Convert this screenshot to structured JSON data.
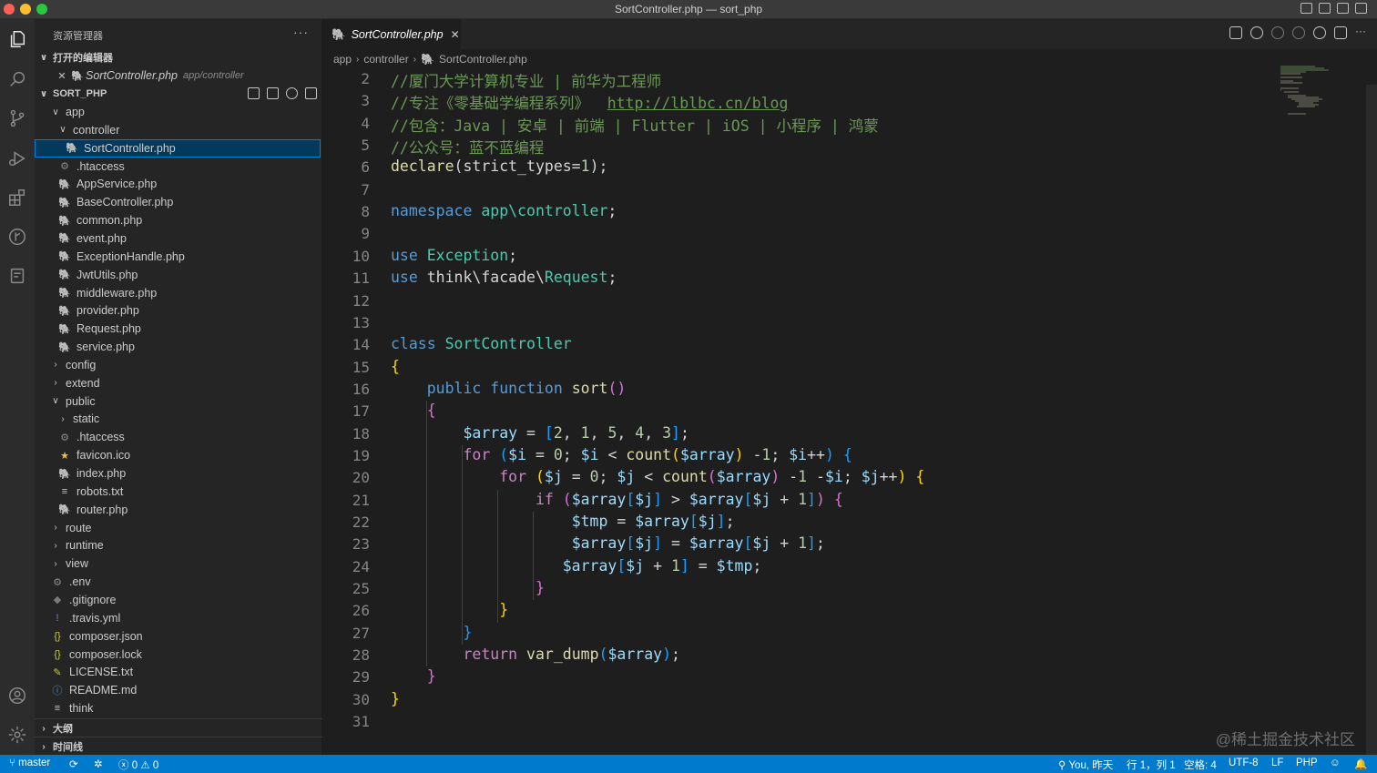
{
  "window": {
    "title": "SortController.php — sort_php"
  },
  "activity_bar": [
    "explorer-icon",
    "search-icon",
    "source-control-icon",
    "run-debug-icon",
    "extensions-icon",
    "git-graph-icon",
    "remote-icon",
    "account-icon",
    "settings-gear-icon"
  ],
  "sidebar": {
    "title": "资源管理器",
    "more": "···",
    "open_editors": {
      "header": "打开的编辑器",
      "file": "SortController.php",
      "path": "app/controller"
    },
    "project": {
      "header": "SORT_PHP"
    },
    "tree": [
      {
        "label": "app",
        "kind": "folder-open",
        "depth": 0
      },
      {
        "label": "controller",
        "kind": "folder-open",
        "depth": 1
      },
      {
        "label": "SortController.php",
        "kind": "php",
        "depth": 2,
        "selected": true
      },
      {
        "label": ".htaccess",
        "kind": "cog",
        "depth": 1
      },
      {
        "label": "AppService.php",
        "kind": "php",
        "depth": 1
      },
      {
        "label": "BaseController.php",
        "kind": "php",
        "depth": 1
      },
      {
        "label": "common.php",
        "kind": "php",
        "depth": 1
      },
      {
        "label": "event.php",
        "kind": "php",
        "depth": 1
      },
      {
        "label": "ExceptionHandle.php",
        "kind": "php",
        "depth": 1
      },
      {
        "label": "JwtUtils.php",
        "kind": "php",
        "depth": 1
      },
      {
        "label": "middleware.php",
        "kind": "php",
        "depth": 1
      },
      {
        "label": "provider.php",
        "kind": "php",
        "depth": 1
      },
      {
        "label": "Request.php",
        "kind": "php",
        "depth": 1
      },
      {
        "label": "service.php",
        "kind": "php",
        "depth": 1
      },
      {
        "label": "config",
        "kind": "folder",
        "depth": 0
      },
      {
        "label": "extend",
        "kind": "folder",
        "depth": 0
      },
      {
        "label": "public",
        "kind": "folder-open",
        "depth": 0
      },
      {
        "label": "static",
        "kind": "folder",
        "depth": 1
      },
      {
        "label": ".htaccess",
        "kind": "cog",
        "depth": 1
      },
      {
        "label": "favicon.ico",
        "kind": "star",
        "depth": 1
      },
      {
        "label": "index.php",
        "kind": "php",
        "depth": 1
      },
      {
        "label": "robots.txt",
        "kind": "txt",
        "depth": 1
      },
      {
        "label": "router.php",
        "kind": "php",
        "depth": 1
      },
      {
        "label": "route",
        "kind": "folder",
        "depth": 0
      },
      {
        "label": "runtime",
        "kind": "folder",
        "depth": 0
      },
      {
        "label": "view",
        "kind": "folder",
        "depth": 0
      },
      {
        "label": ".env",
        "kind": "cog",
        "depth": 0
      },
      {
        "label": ".gitignore",
        "kind": "git",
        "depth": 0
      },
      {
        "label": ".travis.yml",
        "kind": "yml",
        "depth": 0
      },
      {
        "label": "composer.json",
        "kind": "json",
        "depth": 0
      },
      {
        "label": "composer.lock",
        "kind": "json",
        "depth": 0
      },
      {
        "label": "LICENSE.txt",
        "kind": "lic",
        "depth": 0
      },
      {
        "label": "README.md",
        "kind": "info",
        "depth": 0
      },
      {
        "label": "think",
        "kind": "txt",
        "depth": 0
      }
    ],
    "outline": "大纲",
    "timeline": "时间线"
  },
  "editor": {
    "tab": "SortController.php",
    "breadcrumb": [
      "app",
      "controller",
      "SortController.php"
    ],
    "lines": [
      {
        "n": "2",
        "tokens": [
          [
            "c-com",
            "//厦门大学计算机专业 | 前华为工程师"
          ]
        ]
      },
      {
        "n": "3",
        "tokens": [
          [
            "c-com",
            "//专注《零基础学编程系列》  "
          ],
          [
            "c-link",
            "http://lblbc.cn/blog"
          ]
        ]
      },
      {
        "n": "4",
        "tokens": [
          [
            "c-com",
            "//包含：Java | 安卓 | 前端 | Flutter | iOS | 小程序 | 鸿蒙"
          ]
        ]
      },
      {
        "n": "5",
        "tokens": [
          [
            "c-com",
            "//公众号：蓝不蓝编程"
          ]
        ]
      },
      {
        "n": "6",
        "tokens": [
          [
            "c-fn",
            "declare"
          ],
          [
            "",
            "(strict_types="
          ],
          [
            "c-num",
            "1"
          ],
          [
            "",
            ");"
          ]
        ]
      },
      {
        "n": "7",
        "tokens": []
      },
      {
        "n": "8",
        "tokens": [
          [
            "c-kw",
            "namespace "
          ],
          [
            "c-cls",
            "app\\controller"
          ],
          [
            "",
            ";"
          ]
        ]
      },
      {
        "n": "9",
        "tokens": []
      },
      {
        "n": "10",
        "tokens": [
          [
            "c-kw",
            "use "
          ],
          [
            "c-cls",
            "Exception"
          ],
          [
            "",
            ";"
          ]
        ]
      },
      {
        "n": "11",
        "tokens": [
          [
            "c-kw",
            "use "
          ],
          [
            "c-ns",
            "think\\facade\\"
          ],
          [
            "c-cls",
            "Request"
          ],
          [
            "",
            ";"
          ]
        ]
      },
      {
        "n": "12",
        "tokens": []
      },
      {
        "n": "13",
        "tokens": []
      },
      {
        "n": "14",
        "tokens": [
          [
            "c-kw",
            "class "
          ],
          [
            "c-cls",
            "SortController"
          ]
        ]
      },
      {
        "n": "15",
        "tokens": [
          [
            "b1",
            "{"
          ]
        ]
      },
      {
        "n": "16",
        "tokens": [
          [
            "",
            "    "
          ],
          [
            "c-kw",
            "public "
          ],
          [
            "c-kw",
            "function "
          ],
          [
            "c-fn",
            "sort"
          ],
          [
            "b2",
            "()"
          ]
        ]
      },
      {
        "n": "17",
        "tokens": [
          [
            "",
            "    "
          ],
          [
            "b2",
            "{"
          ]
        ]
      },
      {
        "n": "18",
        "tokens": [
          [
            "",
            "        "
          ],
          [
            "c-var",
            "$array"
          ],
          [
            "",
            " = "
          ],
          [
            "b3",
            "["
          ],
          [
            "c-num",
            "2"
          ],
          [
            "",
            ", "
          ],
          [
            "c-num",
            "1"
          ],
          [
            "",
            ", "
          ],
          [
            "c-num",
            "5"
          ],
          [
            "",
            ", "
          ],
          [
            "c-num",
            "4"
          ],
          [
            "",
            ", "
          ],
          [
            "c-num",
            "3"
          ],
          [
            "b3",
            "]"
          ],
          [
            "",
            ";"
          ]
        ]
      },
      {
        "n": "19",
        "tokens": [
          [
            "",
            "        "
          ],
          [
            "c-ctl",
            "for "
          ],
          [
            "b3",
            "("
          ],
          [
            "c-var",
            "$i"
          ],
          [
            "",
            " = "
          ],
          [
            "c-num",
            "0"
          ],
          [
            "",
            "; "
          ],
          [
            "c-var",
            "$i"
          ],
          [
            "",
            " < "
          ],
          [
            "c-fn",
            "count"
          ],
          [
            "b1",
            "("
          ],
          [
            "c-var",
            "$array"
          ],
          [
            "b1",
            ")"
          ],
          [
            "",
            " -"
          ],
          [
            "c-num",
            "1"
          ],
          [
            "",
            "; "
          ],
          [
            "c-var",
            "$i"
          ],
          [
            "",
            "++"
          ],
          [
            "b3",
            ")"
          ],
          [
            "",
            " "
          ],
          [
            "b3",
            "{"
          ]
        ]
      },
      {
        "n": "20",
        "tokens": [
          [
            "",
            "            "
          ],
          [
            "c-ctl",
            "for "
          ],
          [
            "b1",
            "("
          ],
          [
            "c-var",
            "$j"
          ],
          [
            "",
            " = "
          ],
          [
            "c-num",
            "0"
          ],
          [
            "",
            "; "
          ],
          [
            "c-var",
            "$j"
          ],
          [
            "",
            " < "
          ],
          [
            "c-fn",
            "count"
          ],
          [
            "b2",
            "("
          ],
          [
            "c-var",
            "$array"
          ],
          [
            "b2",
            ")"
          ],
          [
            "",
            " -"
          ],
          [
            "c-num",
            "1"
          ],
          [
            "",
            " -"
          ],
          [
            "c-var",
            "$i"
          ],
          [
            "",
            "; "
          ],
          [
            "c-var",
            "$j"
          ],
          [
            "",
            "++"
          ],
          [
            "b1",
            ")"
          ],
          [
            "",
            " "
          ],
          [
            "b1",
            "{"
          ]
        ]
      },
      {
        "n": "21",
        "tokens": [
          [
            "",
            "                "
          ],
          [
            "c-ctl",
            "if "
          ],
          [
            "b2",
            "("
          ],
          [
            "c-var",
            "$array"
          ],
          [
            "b3",
            "["
          ],
          [
            "c-var",
            "$j"
          ],
          [
            "b3",
            "]"
          ],
          [
            "",
            " > "
          ],
          [
            "c-var",
            "$array"
          ],
          [
            "b3",
            "["
          ],
          [
            "c-var",
            "$j"
          ],
          [
            "",
            " + "
          ],
          [
            "c-num",
            "1"
          ],
          [
            "b3",
            "]"
          ],
          [
            "b2",
            ")"
          ],
          [
            "",
            " "
          ],
          [
            "b2",
            "{"
          ]
        ]
      },
      {
        "n": "22",
        "tokens": [
          [
            "",
            "                    "
          ],
          [
            "c-var",
            "$tmp"
          ],
          [
            "",
            " = "
          ],
          [
            "c-var",
            "$array"
          ],
          [
            "b3",
            "["
          ],
          [
            "c-var",
            "$j"
          ],
          [
            "b3",
            "]"
          ],
          [
            "",
            ";"
          ]
        ]
      },
      {
        "n": "23",
        "tokens": [
          [
            "",
            "                    "
          ],
          [
            "c-var",
            "$array"
          ],
          [
            "b3",
            "["
          ],
          [
            "c-var",
            "$j"
          ],
          [
            "b3",
            "]"
          ],
          [
            "",
            " = "
          ],
          [
            "c-var",
            "$array"
          ],
          [
            "b3",
            "["
          ],
          [
            "c-var",
            "$j"
          ],
          [
            "",
            " + "
          ],
          [
            "c-num",
            "1"
          ],
          [
            "b3",
            "]"
          ],
          [
            "",
            ";"
          ]
        ]
      },
      {
        "n": "24",
        "tokens": [
          [
            "",
            "                   "
          ],
          [
            "c-var",
            "$array"
          ],
          [
            "b3",
            "["
          ],
          [
            "c-var",
            "$j"
          ],
          [
            "",
            " + "
          ],
          [
            "c-num",
            "1"
          ],
          [
            "b3",
            "]"
          ],
          [
            "",
            " = "
          ],
          [
            "c-var",
            "$tmp"
          ],
          [
            "",
            ";"
          ]
        ]
      },
      {
        "n": "25",
        "tokens": [
          [
            "",
            "                "
          ],
          [
            "b2",
            "}"
          ]
        ]
      },
      {
        "n": "26",
        "tokens": [
          [
            "",
            "            "
          ],
          [
            "b1",
            "}"
          ]
        ]
      },
      {
        "n": "27",
        "tokens": [
          [
            "",
            "        "
          ],
          [
            "b3",
            "}"
          ]
        ]
      },
      {
        "n": "28",
        "tokens": [
          [
            "",
            "        "
          ],
          [
            "c-ctl",
            "return "
          ],
          [
            "c-fn",
            "var_dump"
          ],
          [
            "b3",
            "("
          ],
          [
            "c-var",
            "$array"
          ],
          [
            "b3",
            ")"
          ],
          [
            "",
            ";"
          ]
        ]
      },
      {
        "n": "29",
        "tokens": [
          [
            "",
            "    "
          ],
          [
            "b2",
            "}"
          ]
        ]
      },
      {
        "n": "30",
        "tokens": [
          [
            "b1",
            "}"
          ]
        ]
      },
      {
        "n": "31",
        "tokens": []
      }
    ]
  },
  "watermark": "@稀土掘金技术社区",
  "status_bar": {
    "branch": "master",
    "errors": "0",
    "warnings": "0",
    "blame": "You, 昨天",
    "position": "行 1，列 1",
    "spaces": "空格: 4",
    "encoding": "UTF-8",
    "eol": "LF",
    "language": "PHP"
  },
  "colors": {
    "statusbar": "#007acc",
    "selection": "#04395e",
    "php_icon": "#a074c4"
  }
}
